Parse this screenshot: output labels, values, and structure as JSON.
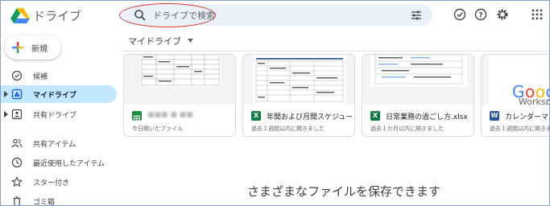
{
  "app": {
    "title": "ドライブ"
  },
  "search": {
    "placeholder": "ドライブで検索"
  },
  "header_icons": [
    "check-circle-icon",
    "help-icon",
    "gear-icon",
    "apps-grid-icon"
  ],
  "sidebar": {
    "new_label": "新規",
    "items": [
      {
        "label": "候補",
        "icon": "check-circle-icon",
        "caret": false,
        "active": false
      },
      {
        "label": "マイドライブ",
        "icon": "drive-icon",
        "caret": true,
        "active": true
      },
      {
        "label": "共有ドライブ",
        "icon": "shared-drive-icon",
        "caret": true,
        "active": false
      },
      {
        "label": "共有アイテム",
        "icon": "people-icon",
        "caret": false,
        "active": false
      },
      {
        "label": "最近使用したアイテム",
        "icon": "clock-icon",
        "caret": false,
        "active": false
      },
      {
        "label": "スター付き",
        "icon": "star-icon",
        "caret": false,
        "active": false
      },
      {
        "label": "ゴミ箱",
        "icon": "trash-icon",
        "caret": false,
        "active": false
      }
    ]
  },
  "main": {
    "breadcrumb": "マイドライブ",
    "cards": [
      {
        "title": "■■■ ■ ■■",
        "subtitle": "今日開いたファイル",
        "type": "sheets",
        "icon_color": "#1e8e3e",
        "icon_letter": ""
      },
      {
        "title": "年間および月間スケジュー",
        "subtitle": "過去１週間以内に開きました",
        "type": "excel",
        "icon_color": "#107c41",
        "icon_letter": "X"
      },
      {
        "title": "日常業務の過ごし方.xlsx",
        "subtitle": "過去１か月以内に開きました",
        "type": "excel",
        "icon_color": "#107c41",
        "icon_letter": "X"
      },
      {
        "title": "カレンダーマニュ",
        "subtitle": "過去１週間以内に開きました",
        "type": "word",
        "icon_color": "#2b579a",
        "icon_letter": "W"
      }
    ],
    "thumb_text": {
      "google": "Google",
      "workspace": "Workspace"
    },
    "drop_text": "さまざまなファイルを保存できます"
  }
}
